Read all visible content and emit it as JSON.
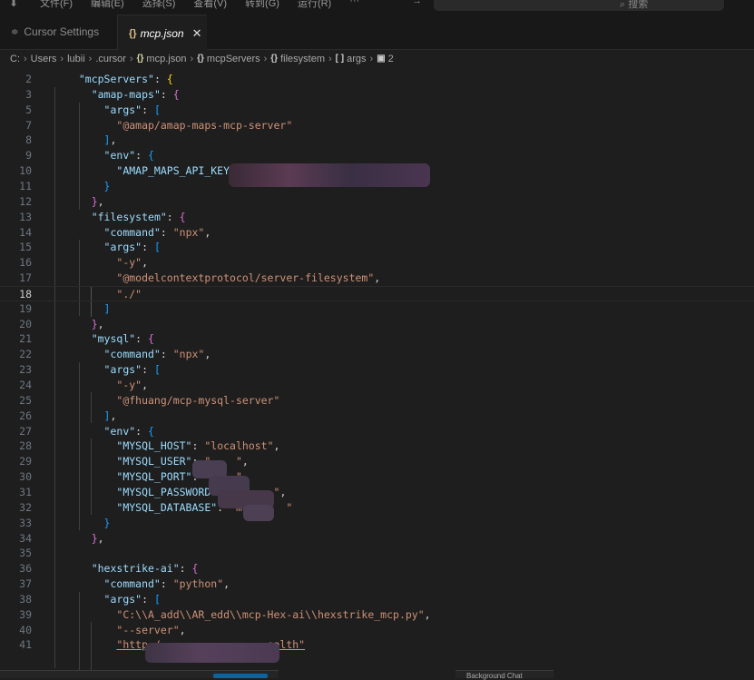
{
  "menubar": {
    "items": [
      "文件(F)",
      "编辑(E)",
      "选择(S)",
      "查看(V)",
      "转到(G)",
      "运行(R)",
      "···"
    ],
    "search_label": "搜索"
  },
  "tabs": [
    {
      "label": "Cursor Settings",
      "active": false
    },
    {
      "label": "mcp.json",
      "active": true
    }
  ],
  "breadcrumb": [
    "C:",
    "Users",
    "lubii",
    ".cursor",
    "mcp.json",
    "mcpServers",
    "filesystem",
    "args",
    "2"
  ],
  "editor": {
    "current_line": 18,
    "lines": [
      {
        "n": 2,
        "code": "  \"mcpServers\": {"
      },
      {
        "n": 3,
        "code": "    \"amap-maps\": {"
      },
      {
        "n": 5,
        "code": "      \"args\": ["
      },
      {
        "n": 7,
        "code": "        \"@amap/amap-maps-mcp-server\""
      },
      {
        "n": 8,
        "code": "      ],"
      },
      {
        "n": 9,
        "code": "      \"env\": {"
      },
      {
        "n": 10,
        "code": "        \"AMAP_MAPS_API_KEY\": \"                          a\""
      },
      {
        "n": 11,
        "code": "      }"
      },
      {
        "n": 12,
        "code": "    },"
      },
      {
        "n": 13,
        "code": "    \"filesystem\": {"
      },
      {
        "n": 14,
        "code": "      \"command\": \"npx\","
      },
      {
        "n": 15,
        "code": "      \"args\": ["
      },
      {
        "n": 16,
        "code": "        \"-y\","
      },
      {
        "n": 17,
        "code": "        \"@modelcontextprotocol/server-filesystem\","
      },
      {
        "n": 18,
        "code": "        \"./\""
      },
      {
        "n": 19,
        "code": "      ]"
      },
      {
        "n": 20,
        "code": "    },"
      },
      {
        "n": 21,
        "code": "    \"mysql\": {"
      },
      {
        "n": 22,
        "code": "      \"command\": \"npx\","
      },
      {
        "n": 23,
        "code": "      \"args\": ["
      },
      {
        "n": 24,
        "code": "        \"-y\","
      },
      {
        "n": 25,
        "code": "        \"@fhuang/mcp-mysql-server\""
      },
      {
        "n": 26,
        "code": "      ],"
      },
      {
        "n": 27,
        "code": "      \"env\": {"
      },
      {
        "n": 28,
        "code": "        \"MYSQL_HOST\": \"localhost\","
      },
      {
        "n": 29,
        "code": "        \"MYSQL_USER\": \"    \","
      },
      {
        "n": 30,
        "code": "        \"MYSQL_PORT\": \"3   \","
      },
      {
        "n": 31,
        "code": "        \"MYSQL_PASSWORD\": \"1     \","
      },
      {
        "n": 32,
        "code": "        \"MYSQL_DATABASE\": \"mcp-    \""
      },
      {
        "n": 33,
        "code": "      }"
      },
      {
        "n": 34,
        "code": "    },"
      },
      {
        "n": 35,
        "code": ""
      },
      {
        "n": 36,
        "code": "    \"hexstrike-ai\": {"
      },
      {
        "n": 37,
        "code": "      \"command\": \"python\","
      },
      {
        "n": 38,
        "code": "      \"args\": ["
      },
      {
        "n": 39,
        "code": "        \"C:\\\\A_add\\\\AR_edd\\\\mcp-Hex-ai\\\\hexstrike_mcp.py\","
      },
      {
        "n": 40,
        "code": "        \"--server\","
      },
      {
        "n": 41,
        "code": "        \"http:/                 ealth\""
      }
    ]
  },
  "bottom_widget_label": "Background Chat",
  "colors": {
    "background": "#1e1e1e",
    "key": "#9cdcfe",
    "string": "#ce9178",
    "bracket_level1": "#ffd700",
    "bracket_level2": "#da70d6",
    "bracket_level3": "#179fff"
  }
}
